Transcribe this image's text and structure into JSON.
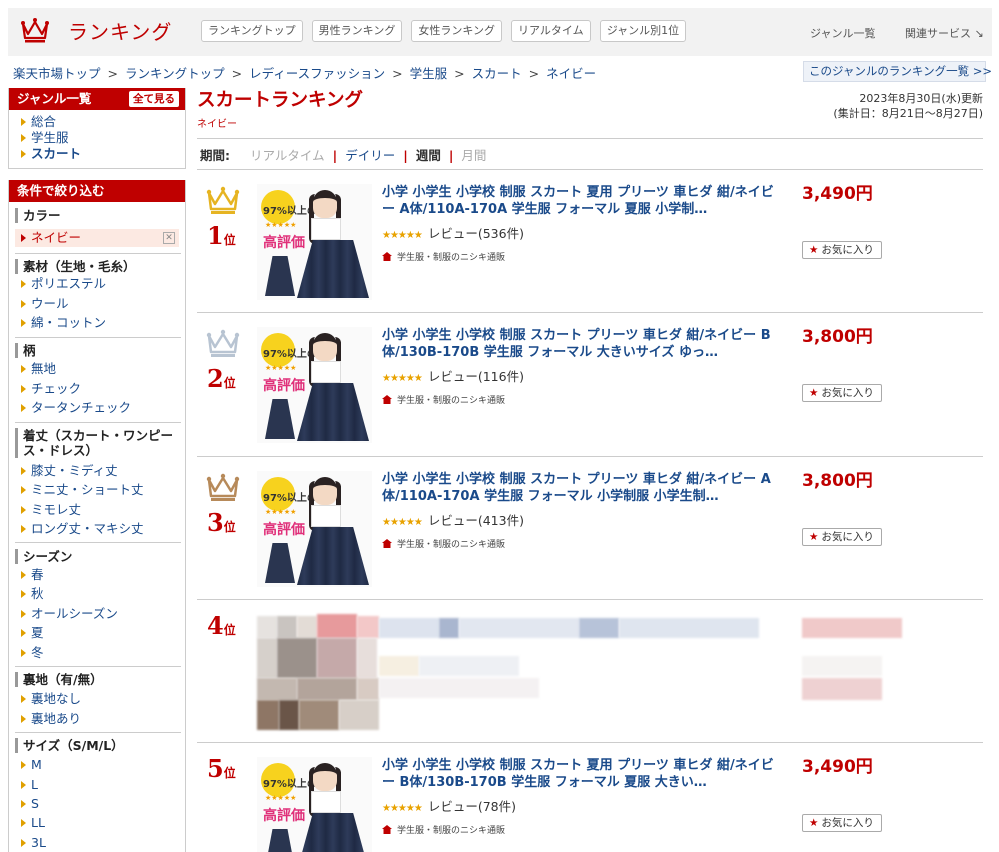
{
  "header": {
    "logo_text": "ランキング",
    "nav": [
      "ランキングトップ",
      "男性ランキング",
      "女性ランキング",
      "リアルタイム",
      "ジャンル別1位"
    ],
    "genre_list_link": "ジャンル一覧",
    "related_services": "関連サービス ↘"
  },
  "breadcrumb": [
    "楽天市場トップ",
    "ランキングトップ",
    "レディースファッション",
    "学生服",
    "スカート",
    "ネイビー"
  ],
  "breadcrumb_sep": ">",
  "genre_ranking_link": "このジャンルのランキング一覧 >>",
  "sidebar": {
    "genre_title": "ジャンル一覧",
    "all_view": "全て見る",
    "genres": [
      "総合",
      "学生服",
      "スカート"
    ],
    "filter_title": "条件で絞り込む",
    "sections": [
      {
        "title": "カラー",
        "items": [
          "ネイビー"
        ]
      },
      {
        "title": "素材（生地・毛糸）",
        "items": [
          "ポリエステル",
          "ウール",
          "綿・コットン"
        ]
      },
      {
        "title": "柄",
        "items": [
          "無地",
          "チェック",
          "タータンチェック"
        ]
      },
      {
        "title": "着丈（スカート・ワンピース・ドレス）",
        "items": [
          "膝丈・ミディ丈",
          "ミニ丈・ショート丈",
          "ミモレ丈",
          "ロング丈・マキシ丈"
        ]
      },
      {
        "title": "シーズン",
        "items": [
          "春",
          "秋",
          "オールシーズン",
          "夏",
          "冬"
        ]
      },
      {
        "title": "裏地（有/無）",
        "items": [
          "裏地なし",
          "裏地あり"
        ]
      },
      {
        "title": "サイズ（S/M/L）",
        "items": [
          "M",
          "L",
          "S",
          "LL",
          "3L"
        ]
      }
    ]
  },
  "main": {
    "title": "スカートランキング",
    "subtitle": "ネイビー",
    "updated": "2023年8月30日(水)更新",
    "period_range": "(集計日：8月21日～8月27日)",
    "period_label": "期間:",
    "period_options": [
      "リアルタイム",
      "デイリー",
      "週間",
      "月間"
    ]
  },
  "items": [
    {
      "rank": "1",
      "rank_suffix": "位",
      "crown_color": "#e6b422",
      "title": "小学 小学生 小学校 制服 スカート 夏用 プリーツ 車ヒダ 紺/ネイビー A体/110A-170A 学生服 フォーマル 夏服 小学制…",
      "reviews": "レビュー(536件)",
      "shop": "学生服・制服のニシキ通販",
      "price": "3,490円",
      "fav": "お気に入り",
      "thumb": {
        "pct": "97%以上の",
        "stars": "★★★★★",
        "label": "高評価"
      }
    },
    {
      "rank": "2",
      "rank_suffix": "位",
      "crown_color": "#b8c4d2",
      "title": "小学 小学生 小学校 制服 スカート プリーツ 車ヒダ 紺/ネイビー B体/130B-170B 学生服 フォーマル 大きいサイズ ゆっ…",
      "reviews": "レビュー(116件)",
      "shop": "学生服・制服のニシキ通販",
      "price": "3,800円",
      "fav": "お気に入り",
      "thumb": {
        "pct": "97%以上の",
        "stars": "★★★★★",
        "label": "高評価"
      }
    },
    {
      "rank": "3",
      "rank_suffix": "位",
      "crown_color": "#b78a5a",
      "title": "小学 小学生 小学校 制服 スカート プリーツ 車ヒダ 紺/ネイビー A体/110A-170A 学生服 フォーマル 小学制服 小学生制…",
      "reviews": "レビュー(413件)",
      "shop": "学生服・制服のニシキ通販",
      "price": "3,800円",
      "fav": "お気に入り",
      "thumb": {
        "pct": "97%以上の",
        "stars": "★★★★★",
        "label": "高評価"
      }
    },
    {
      "rank": "4",
      "rank_suffix": "位"
    },
    {
      "rank": "5",
      "rank_suffix": "位",
      "title": "小学 小学生 小学校 制服 スカート 夏用 プリーツ 車ヒダ 紺/ネイビー B体/130B-170B 学生服 フォーマル 夏服 大きい…",
      "reviews": "レビュー(78件)",
      "shop": "学生服・制服のニシキ通販",
      "price": "3,490円",
      "fav": "お気に入り",
      "thumb": {
        "pct": "97%以上の",
        "stars": "★★★★★",
        "label": "高評価"
      }
    }
  ],
  "colors": {
    "accent": "#bf0000",
    "link": "#1a4a8a",
    "star": "#e8a200"
  }
}
